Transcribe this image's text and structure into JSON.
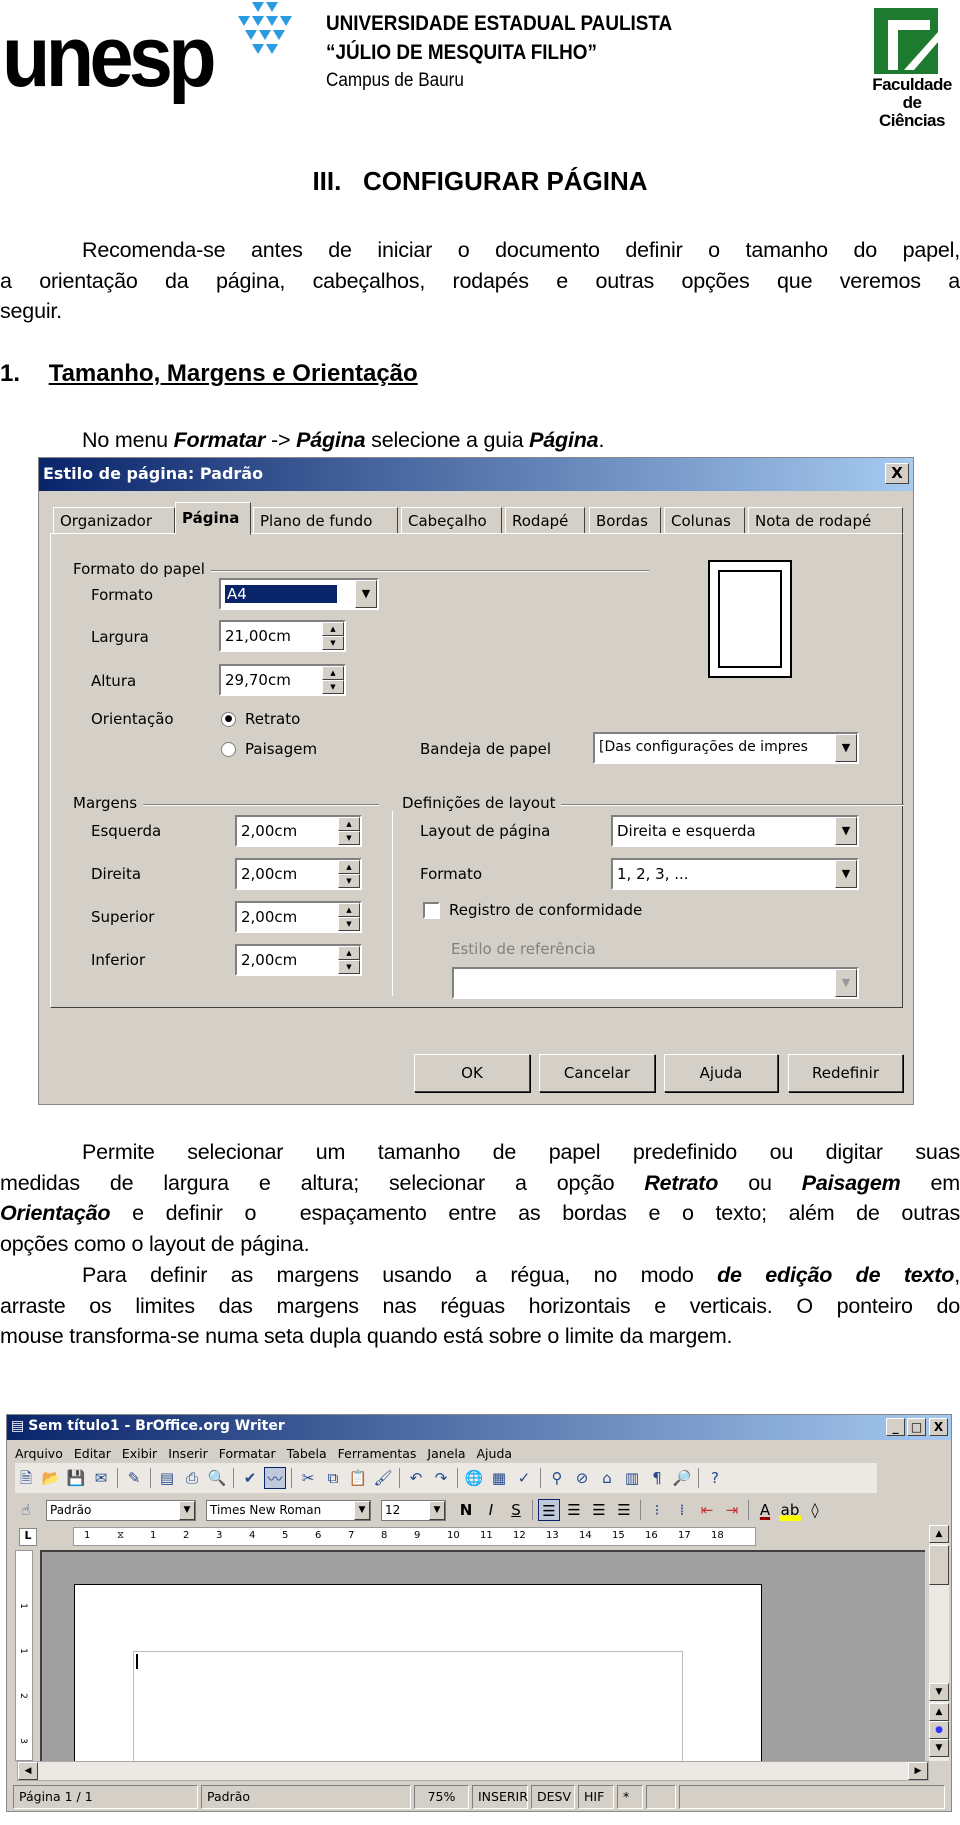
{
  "header": {
    "logo_text": "unesp",
    "university": "UNIVERSIDADE ESTADUAL PAULISTA",
    "university_sub": "“JÚLIO DE MESQUITA FILHO”",
    "campus": "Campus de Bauru",
    "faculty_line1": "Faculdade",
    "faculty_line2": "de Ciências",
    "colors": {
      "unesp_blue": "#2a9be0",
      "faculty_green": "#1e7a2e"
    }
  },
  "section_title": "III.   CONFIGURAR PÁGINA",
  "intro": {
    "lines": [
      "Recomenda-se antes de iniciar o documento definir o tamanho do papel,",
      "a orientação da página, cabeçalhos, rodapés e outras opções que veremos a",
      "seguir."
    ]
  },
  "subsection": {
    "number": "1.",
    "title": "Tamanho, Margens e Orientação"
  },
  "instruction": {
    "prefix": "No menu ",
    "menu": "Formatar",
    "arrow": " -> ",
    "item": "Página",
    "middle": " selecione a guia ",
    "tab": "Página",
    "end": "."
  },
  "dialog": {
    "title": "Estilo de página: Padrão",
    "close": "X",
    "tabs": [
      "Organizador",
      "Página",
      "Plano de fundo",
      "Cabeçalho",
      "Rodapé",
      "Bordas",
      "Colunas",
      "Nota de rodapé"
    ],
    "active_tab": "Página",
    "paper_format": {
      "group": "Formato do papel",
      "format_label": "Formato",
      "format_value": "A4",
      "width_label": "Largura",
      "width_value": "21,00cm",
      "height_label": "Altura",
      "height_value": "29,70cm",
      "orientation_label": "Orientação",
      "portrait": "Retrato",
      "landscape": "Paisagem",
      "selected": "Retrato",
      "tray_label": "Bandeja de papel",
      "tray_value": "[Das configurações de impres"
    },
    "margins": {
      "group": "Margens",
      "left_label": "Esquerda",
      "left_value": "2,00cm",
      "right_label": "Direita",
      "right_value": "2,00cm",
      "top_label": "Superior",
      "top_value": "2,00cm",
      "bottom_label": "Inferior",
      "bottom_value": "2,00cm"
    },
    "layout": {
      "group": "Definições de layout",
      "page_layout_label": "Layout de página",
      "page_layout_value": "Direita e esquerda",
      "format_label": "Formato",
      "format_value": "1, 2, 3, ...",
      "register_label": "Registro de conformidade",
      "register_checked": false,
      "ref_style_label": "Estilo de referência",
      "ref_style_value": ""
    },
    "buttons": {
      "ok": "OK",
      "cancel": "Cancelar",
      "help": "Ajuda",
      "reset": "Redefinir"
    }
  },
  "explanation": {
    "p1": [
      {
        "t": "Permite selecionar um tamanho de papel predefinido ou digitar suas"
      },
      {
        "t": "medidas de largura e altura; selecionar a opção ",
        "b1": "Retrato",
        "m": " ou ",
        "b2": "Paisagem",
        "e": " em"
      },
      {
        "b0": "Orientação",
        "t": " e definir o  espaçamento entre as bordas e o texto; além de outras"
      },
      {
        "t": "opções como o layout de página."
      }
    ],
    "p2": [
      {
        "t": "Para definir as margens usando a régua, no modo ",
        "b": "de edição de texto",
        "e": ","
      },
      {
        "t": "arraste os limites das margens nas réguas horizontais e verticais. O ponteiro do"
      },
      {
        "t": "mouse transforma-se numa seta dupla quando está sobre o limite da margem."
      }
    ]
  },
  "writer": {
    "title": "Sem título1 - BrOffice.org Writer",
    "window_buttons": [
      "_",
      "□",
      "X"
    ],
    "menu": [
      "Arquivo",
      "Editar",
      "Exibir",
      "Inserir",
      "Formatar",
      "Tabela",
      "Ferramentas",
      "Janela",
      "Ajuda"
    ],
    "toolbar_icons": [
      "new-icon",
      "open-icon",
      "save-icon",
      "email-icon",
      "|",
      "edit-file-icon",
      "|",
      "export-pdf-icon",
      "print-icon",
      "page-preview-icon",
      "|",
      "spellcheck-icon",
      "autospellcheck-icon",
      "|",
      "cut-icon",
      "copy-icon",
      "paste-icon",
      "clone-format-icon",
      "|",
      "undo-icon",
      "redo-icon",
      "|",
      "hyperlink-icon",
      "table-icon",
      "show-draw-functions-icon",
      "|",
      "find-replace-icon",
      "navigator-icon",
      "gallery-icon",
      "data-sources-icon",
      "nonprinting-chars-icon",
      "zoom-icon",
      "|",
      "help-icon"
    ],
    "format_bar": {
      "style": "Padrão",
      "font": "Times New Roman",
      "size": "12",
      "bold": "N",
      "italic": "I",
      "underline": "S"
    },
    "ruler_labels": [
      "1",
      "",
      "1",
      "2",
      "3",
      "4",
      "5",
      "6",
      "7",
      "8",
      "9",
      "10",
      "11",
      "12",
      "13",
      "14",
      "15",
      "16",
      "17",
      "18"
    ],
    "vruler_labels": [
      "1",
      "1",
      "2",
      "3"
    ],
    "ruler_corner": "L",
    "status": {
      "page": "Página 1 / 1",
      "style": "Padrão",
      "zoom": "75%",
      "insert": "INSERIR",
      "selection": "DESV",
      "hyphen": "HIF",
      "modified": "*"
    }
  }
}
